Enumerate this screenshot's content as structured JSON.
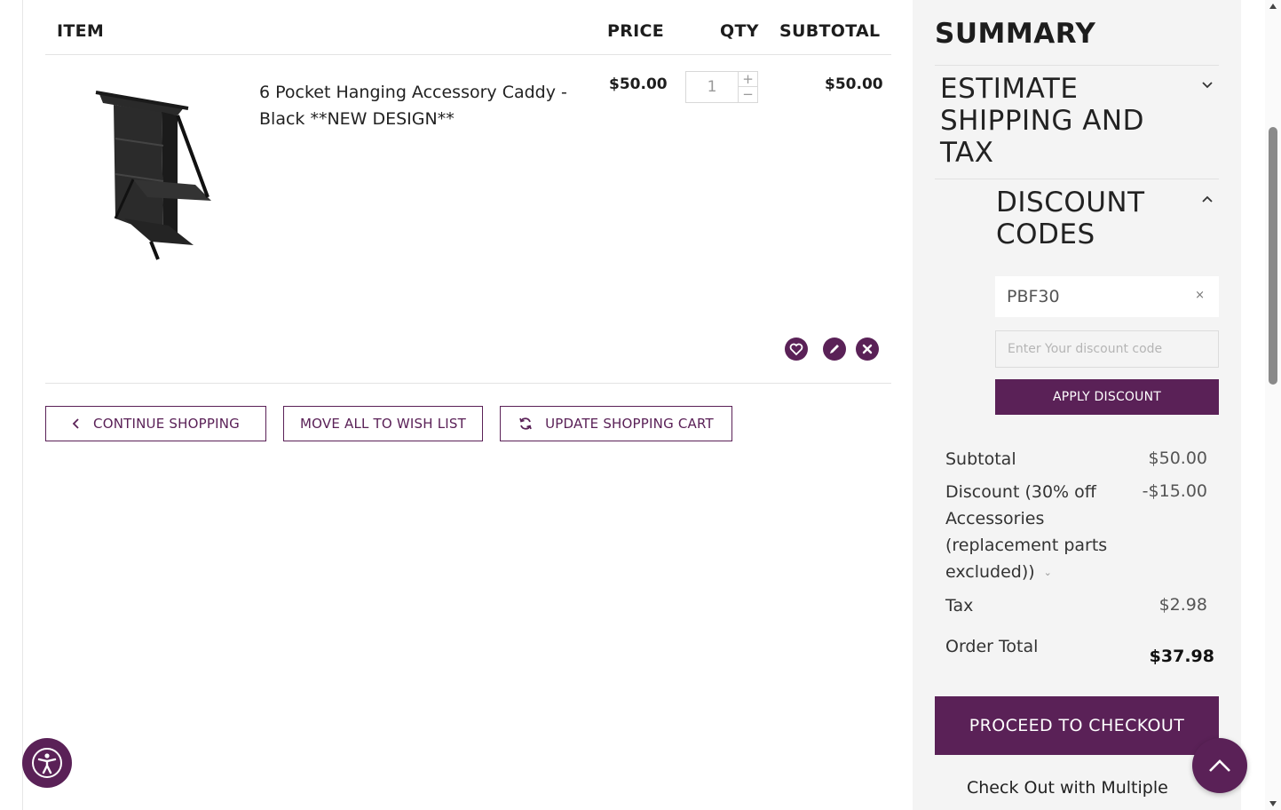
{
  "cart": {
    "headers": {
      "item": "ITEM",
      "price": "PRICE",
      "qty": "QTY",
      "subtotal": "SUBTOTAL"
    },
    "items": [
      {
        "name": "6 Pocket Hanging Accessory Caddy - Black **NEW DESIGN**",
        "price": "$50.00",
        "qty": "1",
        "subtotal": "$50.00",
        "image_icon": "caddy-product-image"
      }
    ],
    "actions": {
      "continue_label": "CONTINUE SHOPPING",
      "wishlist_label": "MOVE ALL TO WISH LIST",
      "update_label": "UPDATE SHOPPING CART"
    }
  },
  "summary": {
    "title": "SUMMARY",
    "shipping_title": "ESTIMATE SHIPPING AND TAX",
    "discount_title": "DISCOUNT CODES",
    "applied_code": "PBF30",
    "applied_remove": "×",
    "discount_placeholder": "Enter Your discount code",
    "apply_label": "APPLY DISCOUNT",
    "totals": {
      "subtotal_label": "Subtotal",
      "subtotal_value": "$50.00",
      "discount_label": "Discount (30% off Accessories (replacement parts excluded))",
      "discount_value": "-$15.00",
      "tax_label": "Tax",
      "tax_value": "$2.98",
      "order_total_label": "Order Total",
      "order_total_value": "$37.98"
    },
    "checkout_label": "PROCEED TO CHECKOUT",
    "multi_label": "Check Out with Multiple"
  },
  "colors": {
    "brand": "#5a2157",
    "panel": "#f4f4f4"
  }
}
